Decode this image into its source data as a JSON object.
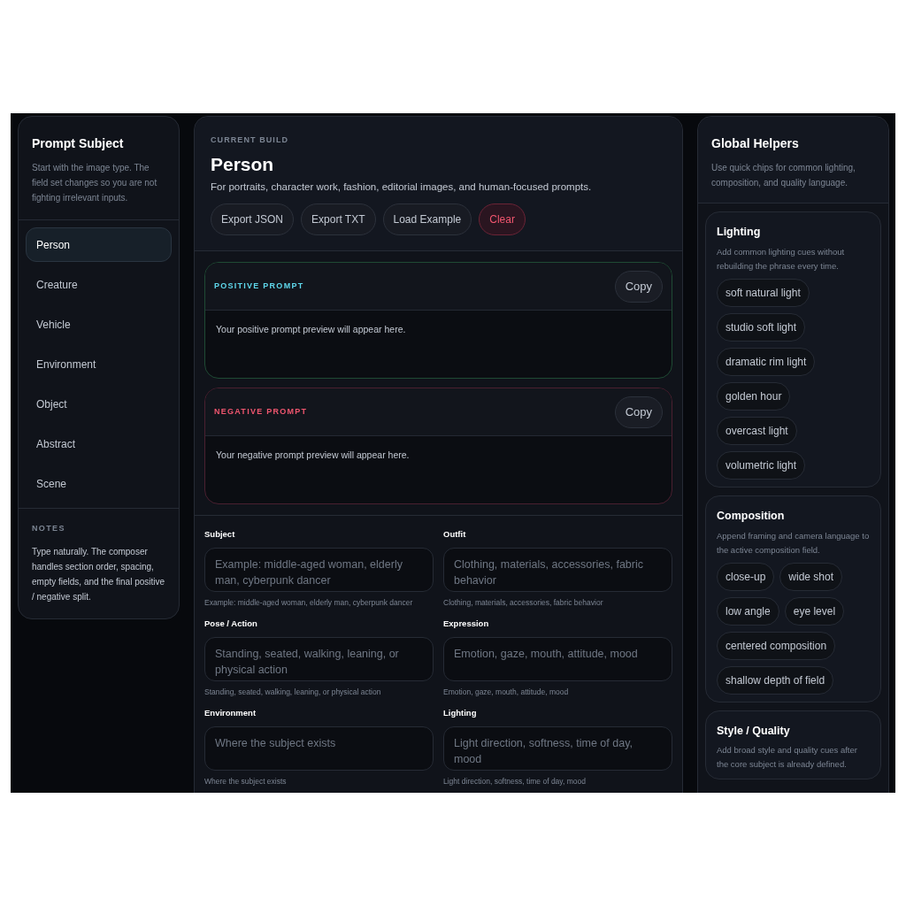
{
  "subject_panel": {
    "title": "Prompt Subject",
    "description": "Start with the image type. The field set changes so you are not fighting irrelevant inputs.",
    "items": [
      {
        "label": "Person",
        "selected": true
      },
      {
        "label": "Creature",
        "selected": false
      },
      {
        "label": "Vehicle",
        "selected": false
      },
      {
        "label": "Environment",
        "selected": false
      },
      {
        "label": "Object",
        "selected": false
      },
      {
        "label": "Abstract",
        "selected": false
      },
      {
        "label": "Scene",
        "selected": false
      }
    ],
    "notes": {
      "heading": "NOTES",
      "text": "Type naturally. The composer handles section order, spacing, empty fields, and the final positive / negative split."
    }
  },
  "build": {
    "eyebrow": "CURRENT BUILD",
    "title": "Person",
    "description": "For portraits, character work, fashion, editorial images, and human-focused prompts.",
    "actions": [
      {
        "label": "Export JSON",
        "kind": "normal"
      },
      {
        "label": "Export TXT",
        "kind": "normal"
      },
      {
        "label": "Load Example",
        "kind": "normal"
      },
      {
        "label": "Clear",
        "kind": "danger"
      }
    ],
    "previews": [
      {
        "kind": "positive",
        "label": "POSITIVE PROMPT",
        "copy": "Copy",
        "text": "Your positive prompt preview will appear here."
      },
      {
        "kind": "negative",
        "label": "NEGATIVE PROMPT",
        "copy": "Copy",
        "text": "Your negative prompt preview will appear here."
      }
    ],
    "fields": [
      {
        "label": "Subject",
        "placeholder": "Example: middle-aged woman, elderly man, cyberpunk dancer",
        "hint": "Example: middle-aged woman, elderly man, cyberpunk dancer"
      },
      {
        "label": "Outfit",
        "placeholder": "Clothing, materials, accessories, fabric behavior",
        "hint": "Clothing, materials, accessories, fabric behavior"
      },
      {
        "label": "Pose / Action",
        "placeholder": "Standing, seated, walking, leaning, or physical action",
        "hint": "Standing, seated, walking, leaning, or physical action"
      },
      {
        "label": "Expression",
        "placeholder": "Emotion, gaze, mouth, attitude, mood",
        "hint": "Emotion, gaze, mouth, attitude, mood"
      },
      {
        "label": "Environment",
        "placeholder": "Where the subject exists",
        "hint": "Where the subject exists"
      },
      {
        "label": "Lighting",
        "placeholder": "Light direction, softness, time of day, mood",
        "hint": "Light direction, softness, time of day, mood"
      }
    ]
  },
  "helpers": {
    "title": "Global Helpers",
    "description": "Use quick chips for common lighting, composition, and quality language.",
    "groups": [
      {
        "title": "Lighting",
        "description": "Add common lighting cues without rebuilding the phrase every time.",
        "chips": [
          "soft natural light",
          "studio soft light",
          "dramatic rim light",
          "golden hour",
          "overcast light",
          "volumetric light"
        ]
      },
      {
        "title": "Composition",
        "description": "Append framing and camera language to the active composition field.",
        "chips": [
          "close-up",
          "wide shot",
          "low angle",
          "eye level",
          "centered composition",
          "shallow depth of field"
        ]
      },
      {
        "title": "Style / Quality",
        "description": "Add broad style and quality cues after the core subject is already defined."
      }
    ]
  }
}
